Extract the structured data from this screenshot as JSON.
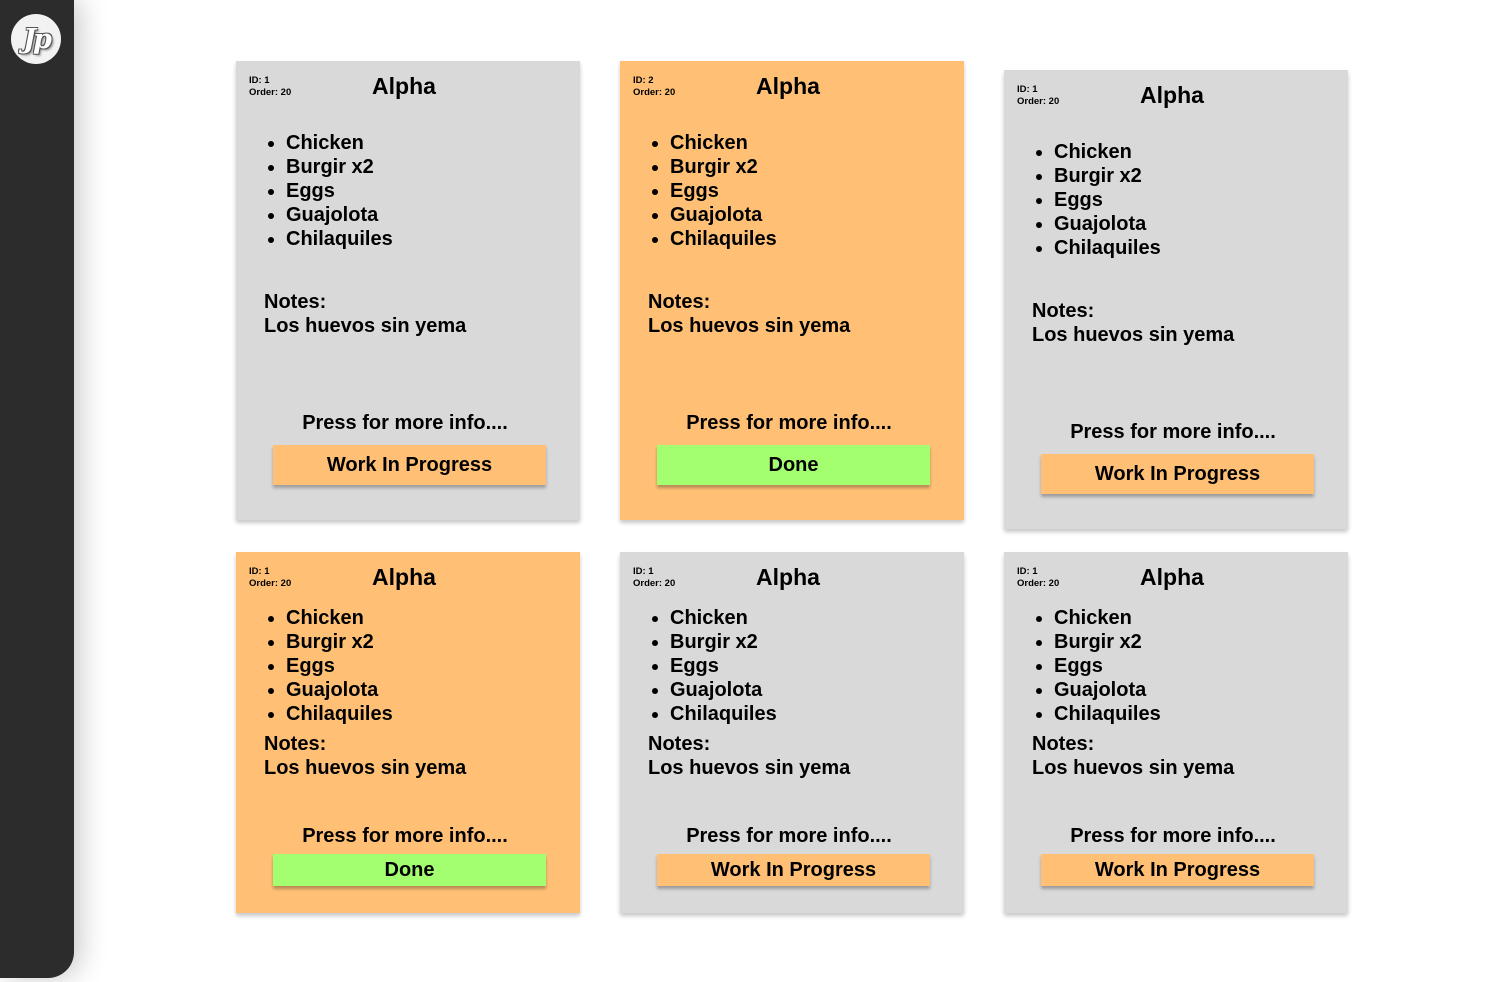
{
  "app": {
    "logo_text": "Jp"
  },
  "cards": [
    {
      "id_label": "ID: 1",
      "order_label": "Order: 20",
      "title": "Alpha",
      "items": [
        "Chicken",
        "Burgir x2",
        "Eggs",
        "Guajolota",
        "Chilaquiles"
      ],
      "notes_label": "Notes:",
      "notes": "Los huevos sin yema",
      "more": "Press for more info....",
      "status": "Work In Progress"
    },
    {
      "id_label": "ID: 2",
      "order_label": "Order: 20",
      "title": "Alpha",
      "items": [
        "Chicken",
        "Burgir x2",
        "Eggs",
        "Guajolota",
        "Chilaquiles"
      ],
      "notes_label": "Notes:",
      "notes": "Los huevos sin yema",
      "more": "Press for more info....",
      "status": "Done"
    },
    {
      "id_label": "ID: 1",
      "order_label": "Order: 20",
      "title": "Alpha",
      "items": [
        "Chicken",
        "Burgir x2",
        "Eggs",
        "Guajolota",
        "Chilaquiles"
      ],
      "notes_label": "Notes:",
      "notes": "Los huevos sin yema",
      "more": "Press for more info....",
      "status": "Work In Progress"
    },
    {
      "id_label": "ID: 1",
      "order_label": "Order: 20",
      "title": "Alpha",
      "items": [
        "Chicken",
        "Burgir x2",
        "Eggs",
        "Guajolota",
        "Chilaquiles"
      ],
      "notes_label": "Notes:",
      "notes": "Los huevos sin yema",
      "more": "Press for more info....",
      "status": "Done"
    },
    {
      "id_label": "ID: 1",
      "order_label": "Order: 20",
      "title": "Alpha",
      "items": [
        "Chicken",
        "Burgir x2",
        "Eggs",
        "Guajolota",
        "Chilaquiles"
      ],
      "notes_label": "Notes:",
      "notes": "Los huevos sin yema",
      "more": "Press for more info....",
      "status": "Work In Progress"
    },
    {
      "id_label": "ID: 1",
      "order_label": "Order: 20",
      "title": "Alpha",
      "items": [
        "Chicken",
        "Burgir x2",
        "Eggs",
        "Guajolota",
        "Chilaquiles"
      ],
      "notes_label": "Notes:",
      "notes": "Los huevos sin yema",
      "more": "Press for more info....",
      "status": "Work In Progress"
    }
  ],
  "colors": {
    "sidebar": "#2c2c2c",
    "card_grey": "#d9d9d9",
    "card_orange": "#ffc076",
    "button_wip": "#ffc076",
    "button_done": "#a3ff70"
  }
}
